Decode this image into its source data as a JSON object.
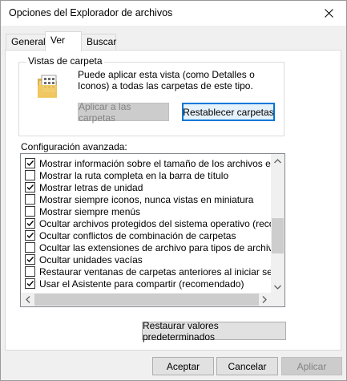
{
  "window": {
    "title": "Opciones del Explorador de archivos"
  },
  "tabs": [
    {
      "label": "General"
    },
    {
      "label": "Ver"
    },
    {
      "label": "Buscar"
    }
  ],
  "folder_views": {
    "group_label": "Vistas de carpeta",
    "description": "Puede aplicar esta vista (como Detalles o Iconos) a todas las carpetas de este tipo.",
    "apply_label": "Aplicar a las carpetas",
    "reset_label": "Restablecer carpetas"
  },
  "advanced": {
    "label": "Configuración avanzada:",
    "items": [
      {
        "label": "Mostrar información sobre el tamaño de los archivos en sugen",
        "checked": true
      },
      {
        "label": "Mostrar la ruta completa en la barra de título",
        "checked": false
      },
      {
        "label": "Mostrar letras de unidad",
        "checked": true
      },
      {
        "label": "Mostrar siempre iconos, nunca vistas en miniatura",
        "checked": false
      },
      {
        "label": "Mostrar siempre menús",
        "checked": false
      },
      {
        "label": "Ocultar archivos protegidos del sistema operativo (recomenda",
        "checked": true
      },
      {
        "label": "Ocultar conflictos de combinación de carpetas",
        "checked": true
      },
      {
        "label": "Ocultar las extensiones de archivo para tipos de archivo conc",
        "checked": false
      },
      {
        "label": "Ocultar unidades vacías",
        "checked": true
      },
      {
        "label": "Restaurar ventanas de carpetas anteriores al iniciar sesión",
        "checked": false
      },
      {
        "label": "Usar el Asistente para compartir (recomendado)",
        "checked": true
      }
    ]
  },
  "restore_defaults_label": "Restaurar valores predeterminados",
  "footer": {
    "ok_label": "Aceptar",
    "cancel_label": "Cancelar",
    "apply_label": "Aplicar"
  },
  "colors": {
    "accent": "#0078d7",
    "window_bg": "#f0f0f0"
  }
}
